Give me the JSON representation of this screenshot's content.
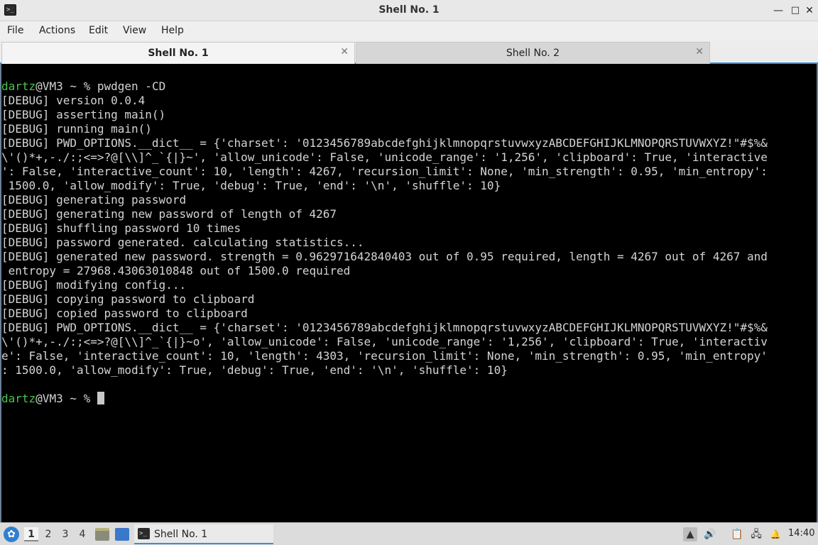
{
  "window": {
    "title": "Shell No. 1",
    "icon_name": "terminal-icon",
    "icon_glyph": ">_",
    "minimize_glyph": "—",
    "maximize_glyph": "□",
    "close_glyph": "✕"
  },
  "menu": [
    "File",
    "Actions",
    "Edit",
    "View",
    "Help"
  ],
  "tabs": [
    {
      "label": "Shell No. 1",
      "close": "✕"
    },
    {
      "label": "Shell No. 2",
      "close": "✕"
    }
  ],
  "terminal": {
    "prompt_user": "dartz",
    "prompt_rest": "@VM3 ~ % ",
    "command": "pwdgen -CD",
    "lines": [
      "[DEBUG] version 0.0.4",
      "[DEBUG] asserting main()",
      "[DEBUG] running main()",
      "[DEBUG] PWD_OPTIONS.__dict__ = {'charset': '0123456789abcdefghijklmnopqrstuvwxyzABCDEFGHIJKLMNOPQRSTUVWXYZ!\"#$%&",
      "\\'()*+,-./:;<=>?@[\\\\]^_`{|}~', 'allow_unicode': False, 'unicode_range': '1,256', 'clipboard': True, 'interactive",
      "': False, 'interactive_count': 10, 'length': 4267, 'recursion_limit': None, 'min_strength': 0.95, 'min_entropy':",
      " 1500.0, 'allow_modify': True, 'debug': True, 'end': '\\n', 'shuffle': 10}",
      "[DEBUG] generating password",
      "[DEBUG] generating new password of length of 4267",
      "[DEBUG] shuffling password 10 times",
      "[DEBUG] password generated. calculating statistics...",
      "[DEBUG] generated new password. strength = 0.962971642840403 out of 0.95 required, length = 4267 out of 4267 and",
      " entropy = 27968.43063010848 out of 1500.0 required",
      "[DEBUG] modifying config...",
      "[DEBUG] copying password to clipboard",
      "[DEBUG] copied password to clipboard",
      "[DEBUG] PWD_OPTIONS.__dict__ = {'charset': '0123456789abcdefghijklmnopqrstuvwxyzABCDEFGHIJKLMNOPQRSTUVWXYZ!\"#$%&",
      "\\'()*+,-./:;<=>?@[\\\\]^_`{|}~o', 'allow_unicode': False, 'unicode_range': '1,256', 'clipboard': True, 'interactiv",
      "e': False, 'interactive_count': 10, 'length': 4303, 'recursion_limit': None, 'min_strength': 0.95, 'min_entropy'",
      ": 1500.0, 'allow_modify': True, 'debug': True, 'end': '\\n', 'shuffle': 10}",
      ""
    ],
    "colors": {
      "prompt_user": "#4ec24e",
      "text": "#d4d4d4",
      "background": "#000000"
    }
  },
  "taskbar": {
    "start_icon": "lubuntu-logo-icon",
    "workspaces": [
      "1",
      "2",
      "3",
      "4"
    ],
    "active_workspace": "1",
    "quick_launch": [
      "file-manager-icon",
      "desktop-icon"
    ],
    "task": {
      "label": "Shell No. 1",
      "icon": "terminal-icon"
    },
    "tray": [
      "tray-arrow-icon",
      "volume-icon",
      "clipboard-icon",
      "network-icon",
      "notification-icon"
    ],
    "clock": "14:40"
  }
}
